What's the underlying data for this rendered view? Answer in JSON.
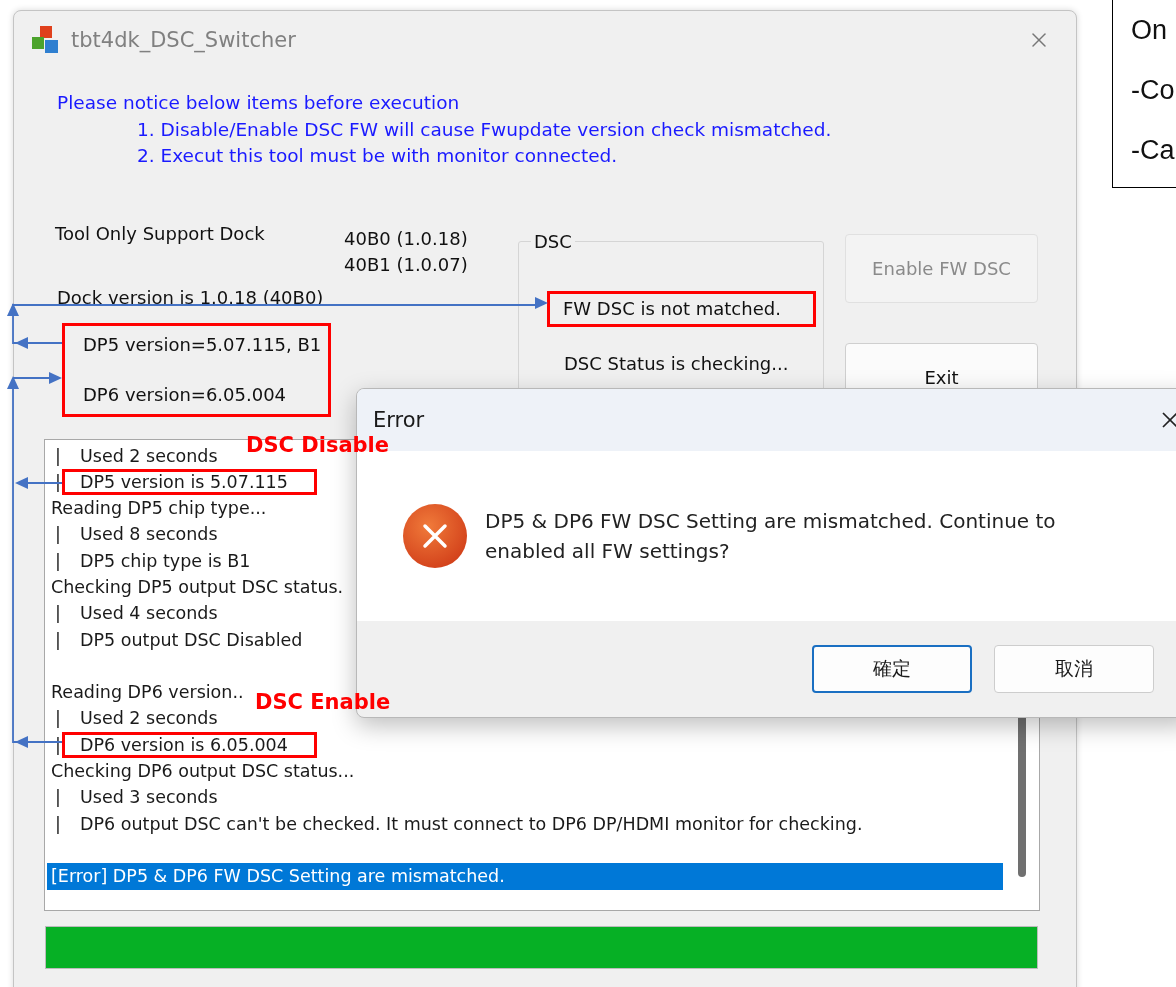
{
  "window": {
    "title": "tbt4dk_DSC_Switcher"
  },
  "notice": {
    "heading": "Please notice below items before execution",
    "items": [
      "1. Disable/Enable DSC FW will cause Fwupdate version check mismatched.",
      "2. Execut this tool must be with monitor connected."
    ]
  },
  "support": {
    "label": "Tool Only Support Dock",
    "versions": [
      "40B0 (1.0.18)",
      "40B1 (1.0.07)"
    ]
  },
  "dock_version": "Dock version is 1.0.18 (40B0)",
  "chip_versions": [
    "DP5 version=5.07.115, B1",
    "DP6 version=6.05.004"
  ],
  "dsc": {
    "title": "DSC",
    "fw_status": "FW DSC is not matched.",
    "status": "DSC Status is checking..."
  },
  "buttons": [
    {
      "label": "Enable FW DSC",
      "disabled": true
    },
    {
      "label": "Exit",
      "disabled": false
    }
  ],
  "log": [
    {
      "kind": "step",
      "prefix": "|",
      "text": "Used 2 seconds",
      "selected": false,
      "boxed": false,
      "annotation": "DSC Disable"
    },
    {
      "kind": "step",
      "prefix": "|",
      "text": "DP5 version is 5.07.115",
      "selected": false,
      "boxed": true
    },
    {
      "kind": "line",
      "text": "Reading DP5 chip type...",
      "selected": false,
      "boxed": false
    },
    {
      "kind": "step",
      "prefix": "|",
      "text": "Used 8 seconds",
      "selected": false,
      "boxed": false
    },
    {
      "kind": "step",
      "prefix": "|",
      "text": "DP5 chip type is B1",
      "selected": false,
      "boxed": false
    },
    {
      "kind": "line",
      "text": "Checking DP5 output DSC status.",
      "selected": false,
      "boxed": false
    },
    {
      "kind": "step",
      "prefix": "|",
      "text": "Used 4 seconds",
      "selected": false,
      "boxed": false
    },
    {
      "kind": "step",
      "prefix": "|",
      "text": "DP5 output DSC Disabled",
      "selected": false,
      "boxed": false
    },
    {
      "kind": "blank"
    },
    {
      "kind": "line",
      "text": "Reading DP6 version..",
      "selected": false,
      "boxed": false
    },
    {
      "kind": "step",
      "prefix": "|",
      "text": "Used 2 seconds",
      "selected": false,
      "boxed": false,
      "annotation": "DSC Enable"
    },
    {
      "kind": "step",
      "prefix": "|",
      "text": "DP6 version is 6.05.004",
      "selected": false,
      "boxed": true
    },
    {
      "kind": "line",
      "text": "Checking DP6 output DSC status...",
      "selected": false,
      "boxed": false
    },
    {
      "kind": "step",
      "prefix": "|",
      "text": "Used 3 seconds",
      "selected": false,
      "boxed": false
    },
    {
      "kind": "step",
      "prefix": "|",
      "text": "DP6 output DSC can't be checked. It must connect to DP6 DP/HDMI monitor for checking.",
      "selected": false,
      "boxed": false
    },
    {
      "kind": "blank"
    },
    {
      "kind": "line",
      "text": "[Error] DP5 & DP6 FW DSC Setting are mismatched.",
      "selected": true,
      "boxed": false
    }
  ],
  "progress": {
    "level": 1
  },
  "dialog": {
    "title": "Error",
    "message": "DP5 & DP6 FW DSC Setting are mismatched. Continue to enabled all FW settings?",
    "buttons": [
      {
        "label": "確定",
        "default": true
      },
      {
        "label": "取消",
        "default": false
      }
    ]
  },
  "note_box": {
    "lines": [
      "On",
      "-Co",
      "-Ca"
    ]
  }
}
